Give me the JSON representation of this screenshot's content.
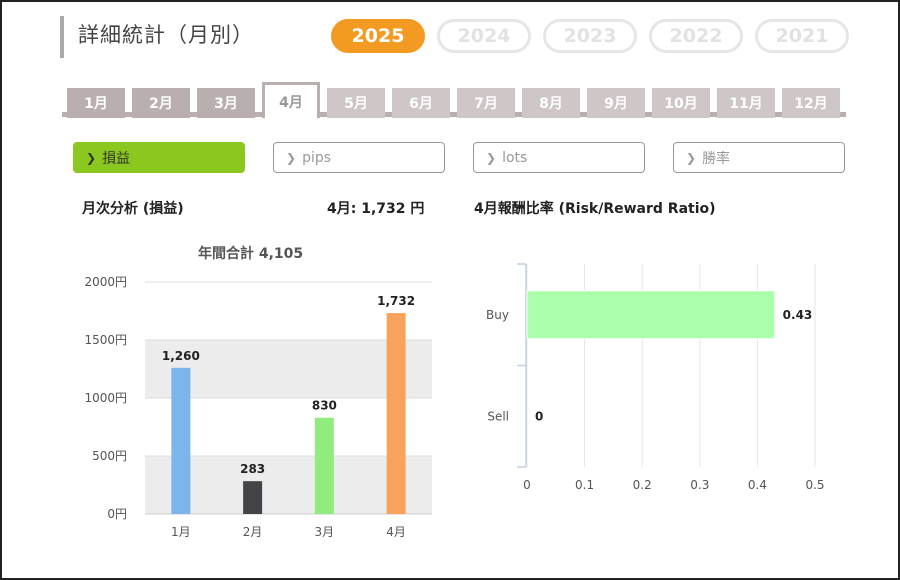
{
  "header": {
    "title": "詳細統計（月別）"
  },
  "years": [
    {
      "label": "2025",
      "active": true
    },
    {
      "label": "2024",
      "active": false
    },
    {
      "label": "2023",
      "active": false
    },
    {
      "label": "2022",
      "active": false
    },
    {
      "label": "2021",
      "active": false
    }
  ],
  "months": [
    {
      "label": "1月",
      "state": "past"
    },
    {
      "label": "2月",
      "state": "past"
    },
    {
      "label": "3月",
      "state": "past"
    },
    {
      "label": "4月",
      "state": "active"
    },
    {
      "label": "5月",
      "state": "future"
    },
    {
      "label": "6月",
      "state": "future"
    },
    {
      "label": "7月",
      "state": "future"
    },
    {
      "label": "8月",
      "state": "future"
    },
    {
      "label": "9月",
      "state": "future"
    },
    {
      "label": "10月",
      "state": "future"
    },
    {
      "label": "11月",
      "state": "future"
    },
    {
      "label": "12月",
      "state": "future"
    }
  ],
  "metrics": [
    {
      "label": "損益",
      "active": true
    },
    {
      "label": "pips",
      "active": false
    },
    {
      "label": "lots",
      "active": false
    },
    {
      "label": "勝率",
      "active": false
    }
  ],
  "monthly": {
    "heading": "月次分析 (損益)",
    "month_value": "4月:  1,732 円",
    "annual_total": "年間合計 4,105"
  },
  "ratio": {
    "heading": "4月報酬比率 (Risk/Reward Ratio)"
  },
  "chart_data": [
    {
      "type": "bar",
      "title": "年間合計 4,105",
      "categories": [
        "1月",
        "2月",
        "3月",
        "4月"
      ],
      "values": [
        1260,
        283,
        830,
        1732
      ],
      "value_labels": [
        "1,260",
        "283",
        "830",
        "1,732"
      ],
      "colors": [
        "#7cb5ec",
        "#434348",
        "#90ed7d",
        "#f7a35c"
      ],
      "ylim": [
        0,
        2000
      ],
      "yticks": [
        "0円",
        "500円",
        "1000円",
        "1500円",
        "2000円"
      ],
      "ytick_values": [
        0,
        500,
        1000,
        1500,
        2000
      ],
      "grid": true
    },
    {
      "type": "bar",
      "orientation": "horizontal",
      "categories": [
        "Buy",
        "Sell"
      ],
      "values": [
        0.43,
        0
      ],
      "value_labels": [
        "0.43",
        "0"
      ],
      "color": "#aaffaa",
      "xlim": [
        0,
        0.5
      ],
      "xticks": [
        "0",
        "0.1",
        "0.2",
        "0.3",
        "0.4",
        "0.5"
      ],
      "xtick_values": [
        0,
        0.1,
        0.2,
        0.3,
        0.4,
        0.5
      ],
      "grid": true
    }
  ]
}
